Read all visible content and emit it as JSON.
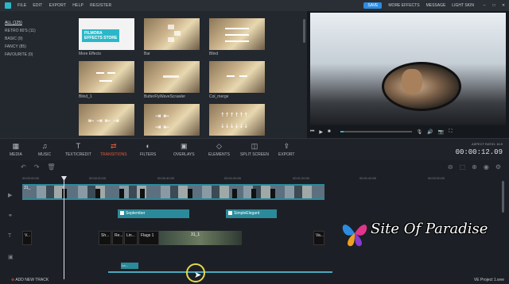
{
  "menubar": {
    "items": [
      "FILE",
      "EDIT",
      "EXPORT",
      "HELP",
      "REGISTER"
    ],
    "save_label": "SAVE",
    "right_items": [
      "MORE EFFECTS",
      "MESSAGE",
      "LIGHT SKIN"
    ],
    "window_controls": [
      "–",
      "□",
      "✕"
    ],
    "accent": "#2d8be0"
  },
  "categories": [
    {
      "label": "ALL (125)",
      "active": true
    },
    {
      "label": "RETRO 80'S (11)"
    },
    {
      "label": "BASIC (9)"
    },
    {
      "label": "FANCY (85)"
    },
    {
      "label": "FAVOURITE (0)"
    }
  ],
  "effects": [
    {
      "label": "More Effects",
      "store_text_1": "FILMORA",
      "store_text_2": "EFFECTS STORE"
    },
    {
      "label": "Bar"
    },
    {
      "label": "Blind"
    },
    {
      "label": "Blind_1"
    },
    {
      "label": "ButterFlyWaveScrawler"
    },
    {
      "label": "Col_merge"
    },
    {
      "label": ""
    },
    {
      "label": ""
    },
    {
      "label": ""
    }
  ],
  "toolbar": {
    "items": [
      {
        "label": "MEDIA",
        "icon": "media-icon"
      },
      {
        "label": "MUSIC",
        "icon": "music-icon"
      },
      {
        "label": "TEXT/CREDIT",
        "icon": "text-icon"
      },
      {
        "label": "TRANSITIONS",
        "icon": "transitions-icon",
        "active": true
      },
      {
        "label": "FILTERS",
        "icon": "filters-icon"
      },
      {
        "label": "OVERLAYS",
        "icon": "overlays-icon"
      },
      {
        "label": "ELEMENTS",
        "icon": "elements-icon"
      },
      {
        "label": "SPLIT SCREEN",
        "icon": "split-screen-icon"
      },
      {
        "label": "EXPORT",
        "icon": "export-icon"
      }
    ],
    "active_color": "#e05a3a",
    "aspect_ratio": "ASPECT RATIO: 16:9",
    "timecode": "00:00:12.09"
  },
  "timeline": {
    "ruler": [
      "00:00:00:00",
      "00:00:20:00",
      "00:00:40:00",
      "00:01:00:00",
      "00:01:20:00",
      "00:01:40:00",
      "00:02:00:00"
    ],
    "video_clip_label": "31_",
    "text_clips": [
      "September",
      "SimpleElegant"
    ],
    "fx_clips": [
      "V...",
      "Sh...",
      "Re...",
      "Lin...",
      "Flags 1",
      "31_1",
      "Va..."
    ],
    "small_clip_label": "Lo...",
    "add_track": "ADD NEW TRACK",
    "project_name": "VE Project 1.wve"
  },
  "watermark": {
    "text": "Site Of Paradise"
  }
}
